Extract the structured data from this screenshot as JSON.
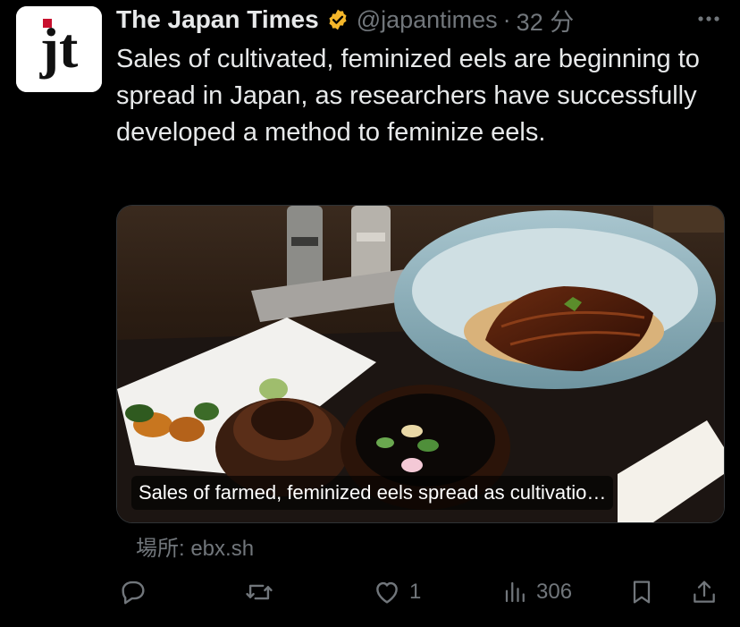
{
  "tweet": {
    "author_name": "The Japan Times",
    "handle": "@japantimes",
    "separator": "·",
    "time": "32 分",
    "text": "Sales of cultivated, feminized eels are beginning to spread in Japan, as researchers have successfully developed a method to feminize eels.",
    "avatar_text": "jt",
    "verified_icon": "verified-badge-icon",
    "verified_color": "#f5b72a",
    "brand_color": "#c8102e"
  },
  "card": {
    "caption": "Sales of farmed, feminized eels spread as cultivatio…",
    "source": "場所: ebx.sh"
  },
  "actions": {
    "reply_icon": "reply-icon",
    "retweet_icon": "retweet-icon",
    "like_icon": "heart-icon",
    "like_count": "1",
    "views_icon": "views-icon",
    "views_count": "306",
    "bookmark_icon": "bookmark-icon",
    "share_icon": "share-icon"
  }
}
